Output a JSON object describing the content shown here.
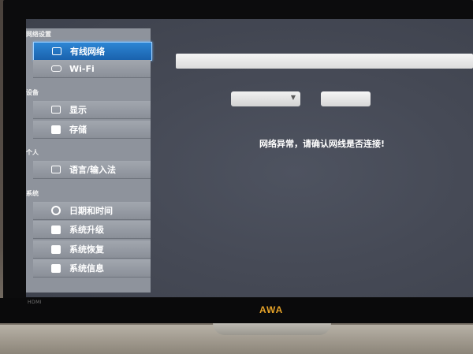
{
  "sidebar": {
    "sections": [
      {
        "label": "网络设置"
      },
      {
        "label": "设备"
      },
      {
        "label": "个人"
      },
      {
        "label": "系统"
      }
    ],
    "items": [
      {
        "label": "有线网络",
        "icon": "monitor-icon"
      },
      {
        "label": "Wi-Fi",
        "icon": "wifi-icon"
      },
      {
        "label": "显示",
        "icon": "display-icon"
      },
      {
        "label": "存储",
        "icon": "folder-icon"
      },
      {
        "label": "语言/输入法",
        "icon": "edit-icon"
      },
      {
        "label": "日期和时间",
        "icon": "clock-icon"
      },
      {
        "label": "系统升级",
        "icon": "upgrade-icon"
      },
      {
        "label": "系统恢复",
        "icon": "restore-icon"
      },
      {
        "label": "系统信息",
        "icon": "info-icon"
      }
    ]
  },
  "main": {
    "message": "网络异常，请确认网线是否连接!"
  },
  "device": {
    "brand": "AWA",
    "port_label": "HDMI"
  },
  "colors": {
    "active_item": "#1a62ad",
    "sidebar_bg": "#8e939c",
    "screen_bg": "#464a56",
    "brand": "#e6a328"
  }
}
